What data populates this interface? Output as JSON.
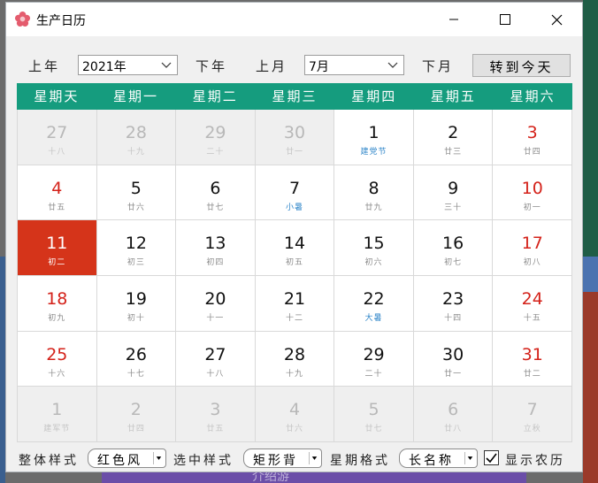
{
  "window": {
    "title": "生产日历"
  },
  "toolbar": {
    "prev_year": "上年",
    "year_value": "2021年",
    "next_year": "下年",
    "prev_month": "上月",
    "month_value": "7月",
    "next_month": "下月",
    "today_button": "转到今天"
  },
  "weekdays": [
    "星期天",
    "星期一",
    "星期二",
    "星期三",
    "星期四",
    "星期五",
    "星期六"
  ],
  "colors": {
    "header": "#159c7e",
    "selected": "#d5341a",
    "weekend": "#d4221a",
    "festival": "#2f86c9"
  },
  "days": [
    {
      "num": "27",
      "lunar": "十八",
      "other": true
    },
    {
      "num": "28",
      "lunar": "十九",
      "other": true
    },
    {
      "num": "29",
      "lunar": "二十",
      "other": true
    },
    {
      "num": "30",
      "lunar": "廿一",
      "other": true
    },
    {
      "num": "1",
      "lunar": "建党节",
      "festival": true
    },
    {
      "num": "2",
      "lunar": "廿三"
    },
    {
      "num": "3",
      "lunar": "廿四",
      "weekend": true
    },
    {
      "num": "4",
      "lunar": "廿五",
      "weekend": true
    },
    {
      "num": "5",
      "lunar": "廿六"
    },
    {
      "num": "6",
      "lunar": "廿七"
    },
    {
      "num": "7",
      "lunar": "小暑",
      "festival": true
    },
    {
      "num": "8",
      "lunar": "廿九"
    },
    {
      "num": "9",
      "lunar": "三十"
    },
    {
      "num": "10",
      "lunar": "初一",
      "weekend": true
    },
    {
      "num": "11",
      "lunar": "初二",
      "weekend": true,
      "selected": true
    },
    {
      "num": "12",
      "lunar": "初三"
    },
    {
      "num": "13",
      "lunar": "初四"
    },
    {
      "num": "14",
      "lunar": "初五"
    },
    {
      "num": "15",
      "lunar": "初六"
    },
    {
      "num": "16",
      "lunar": "初七"
    },
    {
      "num": "17",
      "lunar": "初八",
      "weekend": true
    },
    {
      "num": "18",
      "lunar": "初九",
      "weekend": true
    },
    {
      "num": "19",
      "lunar": "初十"
    },
    {
      "num": "20",
      "lunar": "十一"
    },
    {
      "num": "21",
      "lunar": "十二"
    },
    {
      "num": "22",
      "lunar": "大暑",
      "festival": true
    },
    {
      "num": "23",
      "lunar": "十四"
    },
    {
      "num": "24",
      "lunar": "十五",
      "weekend": true
    },
    {
      "num": "25",
      "lunar": "十六",
      "weekend": true
    },
    {
      "num": "26",
      "lunar": "十七"
    },
    {
      "num": "27",
      "lunar": "十八"
    },
    {
      "num": "28",
      "lunar": "十九"
    },
    {
      "num": "29",
      "lunar": "二十"
    },
    {
      "num": "30",
      "lunar": "廿一"
    },
    {
      "num": "31",
      "lunar": "廿二",
      "weekend": true
    },
    {
      "num": "1",
      "lunar": "建军节",
      "other": true
    },
    {
      "num": "2",
      "lunar": "廿四",
      "other": true
    },
    {
      "num": "3",
      "lunar": "廿五",
      "other": true
    },
    {
      "num": "4",
      "lunar": "廿六",
      "other": true
    },
    {
      "num": "5",
      "lunar": "廿七",
      "other": true
    },
    {
      "num": "6",
      "lunar": "廿八",
      "other": true
    },
    {
      "num": "7",
      "lunar": "立秋",
      "other": true
    }
  ],
  "bottom": {
    "style_label": "整体样式",
    "style_value": "红色风",
    "selected_style_label": "选中样式",
    "selected_style_value": "矩形背",
    "week_format_label": "星期格式",
    "week_format_value": "长名称",
    "show_lunar_checked": true,
    "show_lunar_label": "显示农历"
  },
  "desktop": {
    "bottom_text": "介绍游"
  }
}
